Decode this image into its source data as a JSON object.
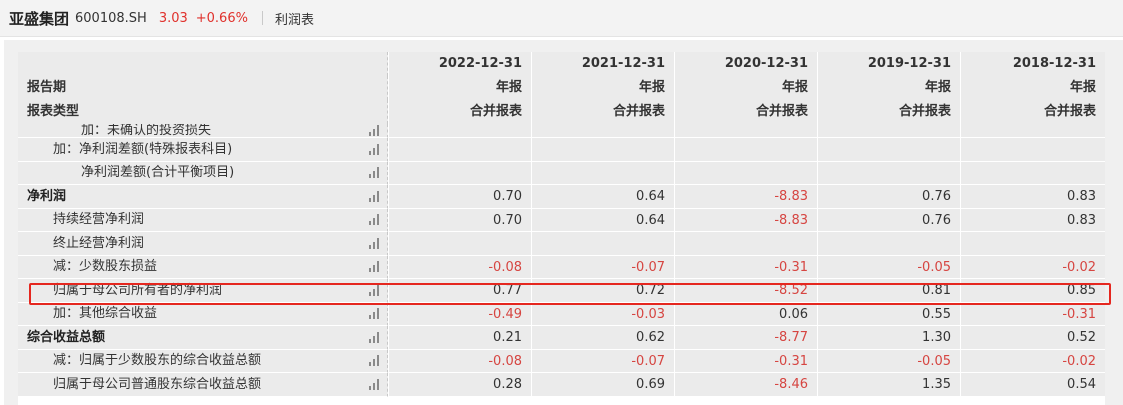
{
  "header": {
    "company": "亚盛集团",
    "code": "600108.SH",
    "price": "3.03",
    "change": "+0.66%",
    "report_type": "利润表"
  },
  "table": {
    "dates": [
      "2022-12-31",
      "2021-12-31",
      "2020-12-31",
      "2019-12-31",
      "2018-12-31"
    ],
    "period_label": "报告期",
    "periods": [
      "年报",
      "年报",
      "年报",
      "年报",
      "年报"
    ],
    "type_label": "报表类型",
    "types": [
      "合并报表",
      "合并报表",
      "合并报表",
      "合并报表",
      "合并报表"
    ],
    "rows": [
      {
        "label": "加：未确认的投资损失",
        "values": [
          "",
          "",
          "",
          "",
          ""
        ]
      },
      {
        "label": "加：净利润差额(特殊报表科目)",
        "values": [
          "",
          "",
          "",
          "",
          ""
        ]
      },
      {
        "label": "净利润差额(合计平衡项目)",
        "values": [
          "",
          "",
          "",
          "",
          ""
        ]
      },
      {
        "label": "净利润",
        "values": [
          "0.70",
          "0.64",
          "-8.83",
          "0.76",
          "0.83"
        ]
      },
      {
        "label": "持续经营净利润",
        "values": [
          "0.70",
          "0.64",
          "-8.83",
          "0.76",
          "0.83"
        ]
      },
      {
        "label": "终止经营净利润",
        "values": [
          "",
          "",
          "",
          "",
          ""
        ]
      },
      {
        "label": "减：少数股东损益",
        "values": [
          "-0.08",
          "-0.07",
          "-0.31",
          "-0.05",
          "-0.02"
        ]
      },
      {
        "label": "归属于母公司所有者的净利润",
        "values": [
          "0.77",
          "0.72",
          "-8.52",
          "0.81",
          "0.85"
        ]
      },
      {
        "label": "加：其他综合收益",
        "values": [
          "-0.49",
          "-0.03",
          "0.06",
          "0.55",
          "-0.31"
        ]
      },
      {
        "label": "综合收益总额",
        "values": [
          "0.21",
          "0.62",
          "-8.77",
          "1.30",
          "0.52"
        ]
      },
      {
        "label": "减：归属于少数股东的综合收益总额",
        "values": [
          "-0.08",
          "-0.07",
          "-0.31",
          "-0.05",
          "-0.02"
        ]
      },
      {
        "label": "归属于母公司普通股东综合收益总额",
        "values": [
          "0.28",
          "0.69",
          "-8.46",
          "1.35",
          "0.54"
        ]
      }
    ]
  },
  "colors": {
    "negative": "#d64541",
    "highlight": "#e5271f",
    "row_bg": "#ebebeb"
  }
}
